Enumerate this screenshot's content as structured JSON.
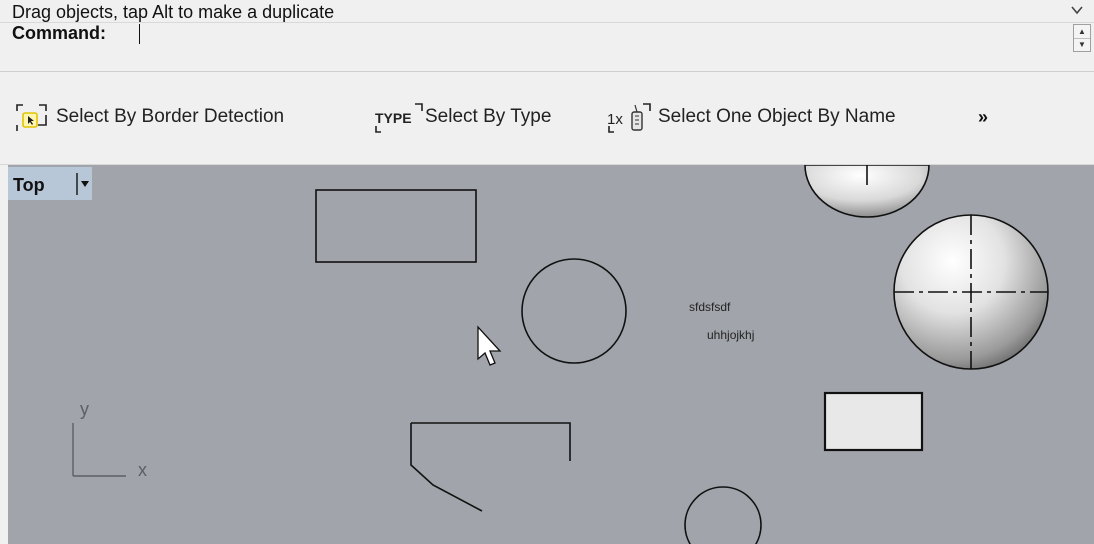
{
  "command_history": {
    "text": "Drag objects, tap Alt to make a duplicate",
    "expand_icon": "chevron-down-icon"
  },
  "command_line": {
    "label": "Command:",
    "value": "",
    "spinner_icon": "spinner-arrows-icon"
  },
  "toolbar": {
    "tools": [
      {
        "label": "Select By Border Detection",
        "icon": "select-border-detection-icon"
      },
      {
        "label": "Select By Type",
        "icon": "select-by-type-icon",
        "icon_text": "TYPE"
      },
      {
        "label": "Select One Object By Name",
        "icon": "select-by-name-icon",
        "icon_text": "1x"
      }
    ],
    "overflow_label": "»"
  },
  "viewport": {
    "title": "Top",
    "menu_icon": "dropdown-arrow-icon",
    "axis_y_label": "y",
    "axis_x_label": "x",
    "text_objects": [
      "sfdsfsdf",
      "uhhjojkhj"
    ],
    "colors": {
      "background": "#a1a5ab",
      "tab_background": "#b8c7d8",
      "curve": "#111111",
      "axis": "#5c5f63",
      "selected_fill": "#e8e8e8"
    }
  }
}
